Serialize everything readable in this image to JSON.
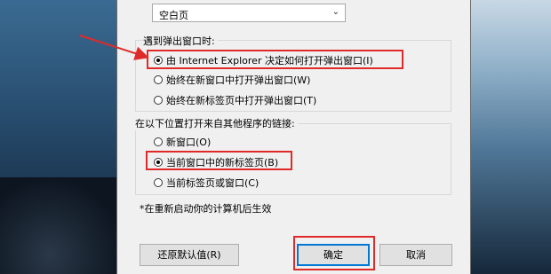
{
  "dropdown": {
    "value": "空白页"
  },
  "popup_group": {
    "label": "遇到弹出窗口时:",
    "options": [
      {
        "label": "由 Internet Explorer 决定如何打开弹出窗口(I)",
        "selected": true
      },
      {
        "label": "始终在新窗口中打开弹出窗口(W)",
        "selected": false
      },
      {
        "label": "始终在新标签页中打开弹出窗口(T)",
        "selected": false
      }
    ]
  },
  "links_group": {
    "label": "在以下位置打开来自其他程序的链接:",
    "options": [
      {
        "label": "新窗口(O)",
        "selected": false
      },
      {
        "label": "当前窗口中的新标签页(B)",
        "selected": true
      },
      {
        "label": "当前标签页或窗口(C)",
        "selected": false
      }
    ]
  },
  "note": "*在重新启动你的计算机后生效",
  "buttons": {
    "restore": "还原默认值(R)",
    "ok": "确定",
    "cancel": "取消"
  },
  "colors": {
    "highlight": "#e02a2a",
    "default_button_border": "#0078d7"
  }
}
